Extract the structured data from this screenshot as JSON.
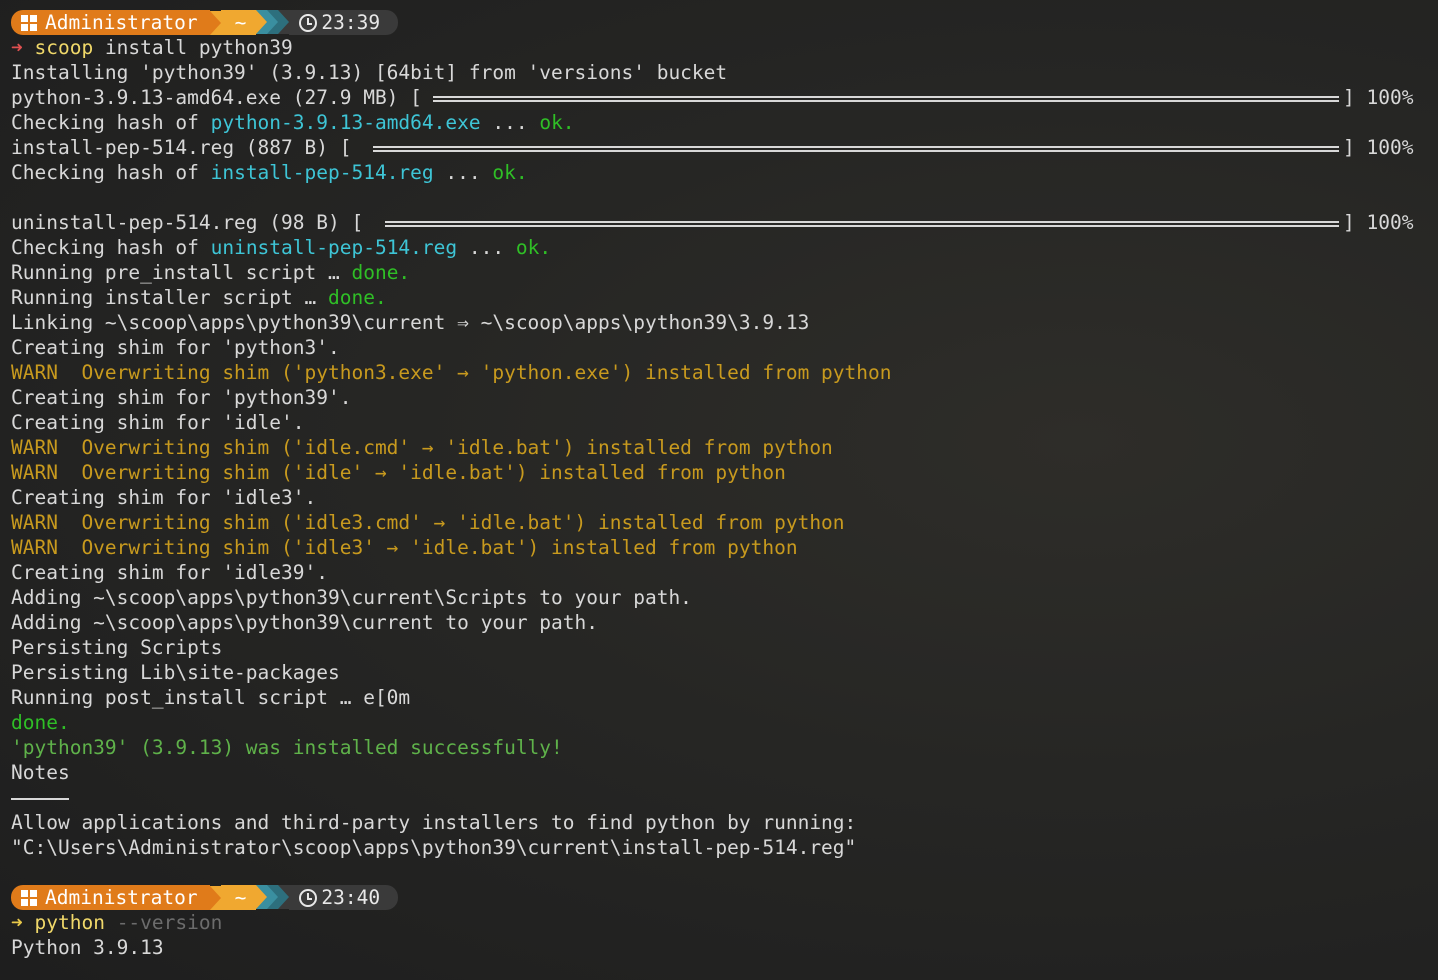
{
  "prompt1": {
    "user": "Administrator",
    "dir": "~",
    "time": "23:39"
  },
  "prompt2": {
    "user": "Administrator",
    "dir": "~",
    "time": "23:40"
  },
  "colors": {
    "orange": "#e07b1a",
    "amber": "#f0a830",
    "teal": "#3a8fa0",
    "cyan": "#3ec5d6",
    "green": "#2fbf26",
    "warn": "#c89a1e"
  },
  "cmd1": {
    "name": "scoop",
    "args": " install python39"
  },
  "cmd2": {
    "name": "python",
    "args": " --version"
  },
  "out": {
    "installing": "Installing 'python39' (3.9.13) [64bit] from 'versions' bucket",
    "dl1_name": "python-3.9.13-amd64.exe (27.9 MB) [",
    "dl1_pct": "] 100%",
    "hash1_pre": "Checking hash of ",
    "hash1_file": "python-3.9.13-amd64.exe",
    "hash1_dots": " ... ",
    "hash1_ok": "ok.",
    "dl2_name": "install-pep-514.reg (887 B) [",
    "dl2_pct": "] 100%",
    "hash2_pre": "Checking hash of ",
    "hash2_file": "install-pep-514.reg",
    "hash2_dots": " ... ",
    "hash2_ok": "ok.",
    "dl3_name": "uninstall-pep-514.reg (98 B) [",
    "dl3_pct": "] 100%",
    "hash3_pre": "Checking hash of ",
    "hash3_file": "uninstall-pep-514.reg",
    "hash3_dots": " ... ",
    "hash3_ok": "ok.",
    "pre_install": "Running pre_install script … ",
    "pre_install_done": "done.",
    "installer": "Running installer script … ",
    "installer_done": "done.",
    "linking": "Linking ~\\scoop\\apps\\python39\\current ⇒ ~\\scoop\\apps\\python39\\3.9.13",
    "shim_python3": "Creating shim for 'python3'.",
    "warn1": "WARN  Overwriting shim ('python3.exe' → 'python.exe') installed from python",
    "shim_python39": "Creating shim for 'python39'.",
    "shim_idle": "Creating shim for 'idle'.",
    "warn2": "WARN  Overwriting shim ('idle.cmd' → 'idle.bat') installed from python",
    "warn3": "WARN  Overwriting shim ('idle' → 'idle.bat') installed from python",
    "shim_idle3": "Creating shim for 'idle3'.",
    "warn4": "WARN  Overwriting shim ('idle3.cmd' → 'idle.bat') installed from python",
    "warn5": "WARN  Overwriting shim ('idle3' → 'idle.bat') installed from python",
    "shim_idle39": "Creating shim for 'idle39'.",
    "add_scripts": "Adding ~\\scoop\\apps\\python39\\current\\Scripts to your path.",
    "add_current": "Adding ~\\scoop\\apps\\python39\\current to your path.",
    "persist_scripts": "Persisting Scripts",
    "persist_lib": "Persisting Lib\\site-packages",
    "post_install": "Running post_install script … e[0m",
    "done": "done.",
    "success": "'python39' (3.9.13) was installed successfully!",
    "notes": "Notes",
    "allow": "Allow applications and third-party installers to find python by running:",
    "reg_path": "\"C:\\Users\\Administrator\\scoop\\apps\\python39\\current\\install-pep-514.reg\"",
    "version": "Python 3.9.13"
  }
}
